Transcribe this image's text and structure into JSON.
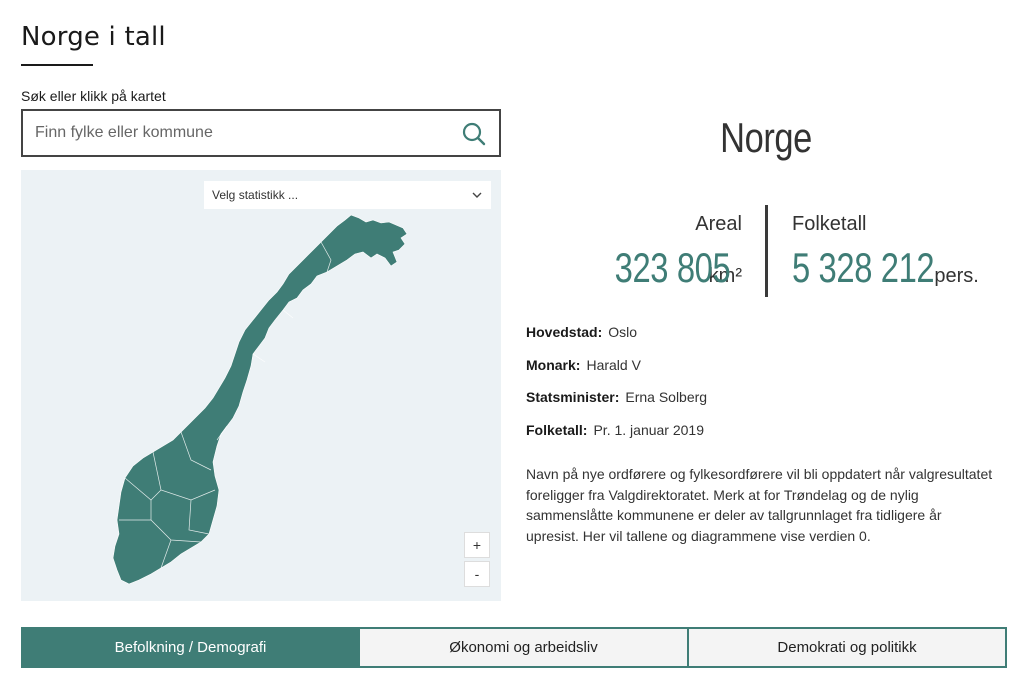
{
  "header": {
    "title": "Norge i tall"
  },
  "search": {
    "label": "Søk eller klikk på kartet",
    "placeholder": "Finn fylke eller kommune"
  },
  "map": {
    "select_placeholder": "Velg statistikk ...",
    "zoom_in": "+",
    "zoom_out": "-",
    "fill_color": "#3f7d76",
    "background_color": "#ecf2f5"
  },
  "summary": {
    "name": "Norge",
    "area_label": "Areal",
    "area_value": "323 805",
    "area_unit": "km²",
    "population_label": "Folketall",
    "population_value": "5 328 212",
    "population_unit": "pers."
  },
  "facts": [
    {
      "key": "Hovedstad:",
      "value": "Oslo"
    },
    {
      "key": "Monark:",
      "value": "Harald V"
    },
    {
      "key": "Statsminister:",
      "value": "Erna Solberg"
    },
    {
      "key": "Folketall:",
      "value": "Pr. 1. januar 2019"
    }
  ],
  "note": "Navn på nye ordførere og fylkesordførere vil bli oppdatert når valgresultatet foreligger fra Valgdirektoratet. Merk at for Trøndelag og de nylig sammenslåtte kommunene er deler av tallgrunnlaget fra tidligere år upresist. Her vil tallene og diagrammene vise verdien 0.",
  "tabs": [
    {
      "label": "Befolkning / Demografi",
      "active": true
    },
    {
      "label": "Økonomi og arbeidsliv",
      "active": false
    },
    {
      "label": "Demokrati og politikk",
      "active": false
    }
  ],
  "colors": {
    "accent": "#3f7d76"
  }
}
